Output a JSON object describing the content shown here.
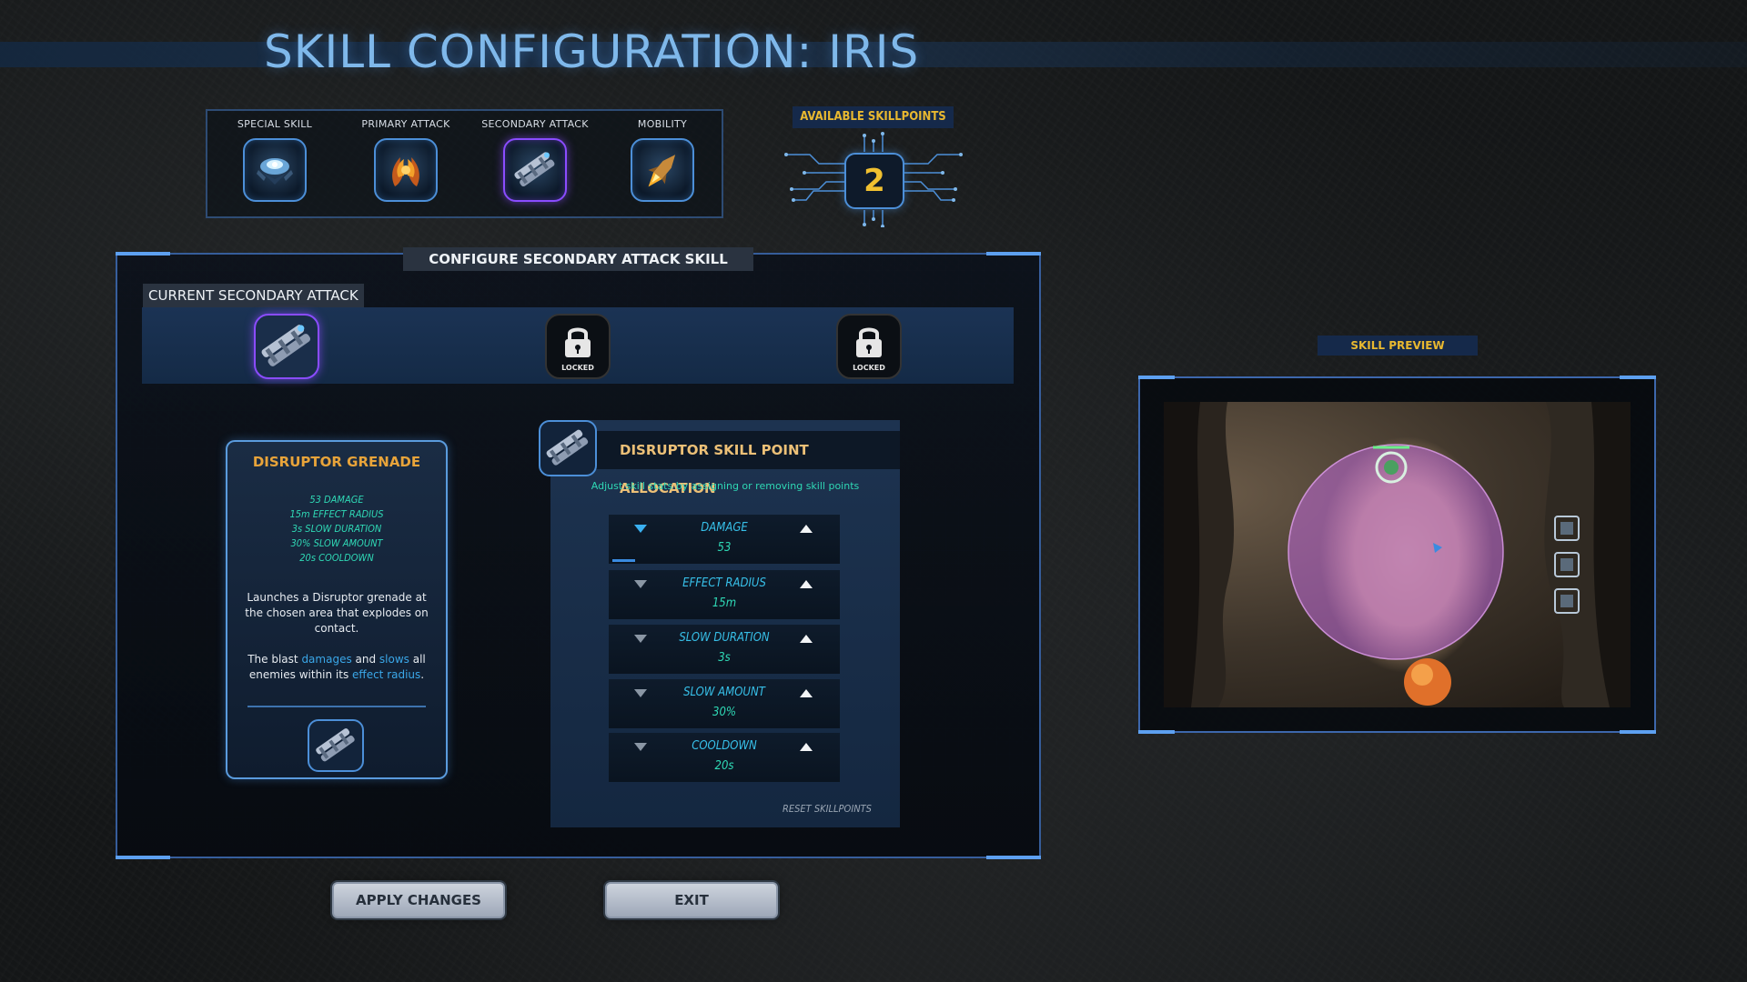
{
  "title": "SKILL CONFIGURATION: IRIS",
  "categories": [
    {
      "label": "SPECIAL SKILL",
      "icon": "shield-drone-icon",
      "selected": false
    },
    {
      "label": "PRIMARY ATTACK",
      "icon": "flame-claws-icon",
      "selected": false
    },
    {
      "label": "SECONDARY ATTACK",
      "icon": "grenade-launcher-icon",
      "selected": true
    },
    {
      "label": "MOBILITY",
      "icon": "rocket-boost-icon",
      "selected": false
    }
  ],
  "skillpoints": {
    "label": "AVAILABLE SKILLPOINTS",
    "value": "2"
  },
  "configure": {
    "header": "CONFIGURE SECONDARY ATTACK SKILL",
    "current_label": "CURRENT SECONDARY ATTACK",
    "slots": [
      {
        "state": "active",
        "icon": "grenade-launcher-icon"
      },
      {
        "state": "locked",
        "label": "LOCKED"
      },
      {
        "state": "locked",
        "label": "LOCKED"
      }
    ]
  },
  "card": {
    "title": "DISRUPTOR GRENADE",
    "stats": [
      "53 DAMAGE",
      "15m EFFECT RADIUS",
      "3s SLOW DURATION",
      "30% SLOW AMOUNT",
      "20s COOLDOWN"
    ],
    "desc1": "Launches a Disruptor grenade at the chosen area that explodes on contact.",
    "desc2": {
      "a": "The blast ",
      "b": "damages",
      "c": " and ",
      "d": "slows",
      "e": " all enemies within its ",
      "f": "effect radius",
      "g": "."
    }
  },
  "allocation": {
    "title": "DISRUPTOR SKILL POINT ALLOCATION",
    "subtitle": "Adjust skill stats by assigning or removing skill points",
    "rows": [
      {
        "name": "DAMAGE",
        "value": "53",
        "points_fraction": 0.1
      },
      {
        "name": "EFFECT RADIUS",
        "value": "15m",
        "points_fraction": 0
      },
      {
        "name": "SLOW DURATION",
        "value": "3s",
        "points_fraction": 0
      },
      {
        "name": "SLOW AMOUNT",
        "value": "30%",
        "points_fraction": 0
      },
      {
        "name": "COOLDOWN",
        "value": "20s",
        "points_fraction": 0
      }
    ],
    "reset": "RESET SKILLPOINTS"
  },
  "buttons": {
    "apply": "APPLY CHANGES",
    "exit": "EXIT"
  },
  "preview": {
    "label": "SKILL PREVIEW"
  },
  "colors": {
    "accent_blue": "#4c8fd8",
    "select_purple": "#8a4cff",
    "gold": "#e8b830",
    "teal": "#2fd8b5"
  }
}
